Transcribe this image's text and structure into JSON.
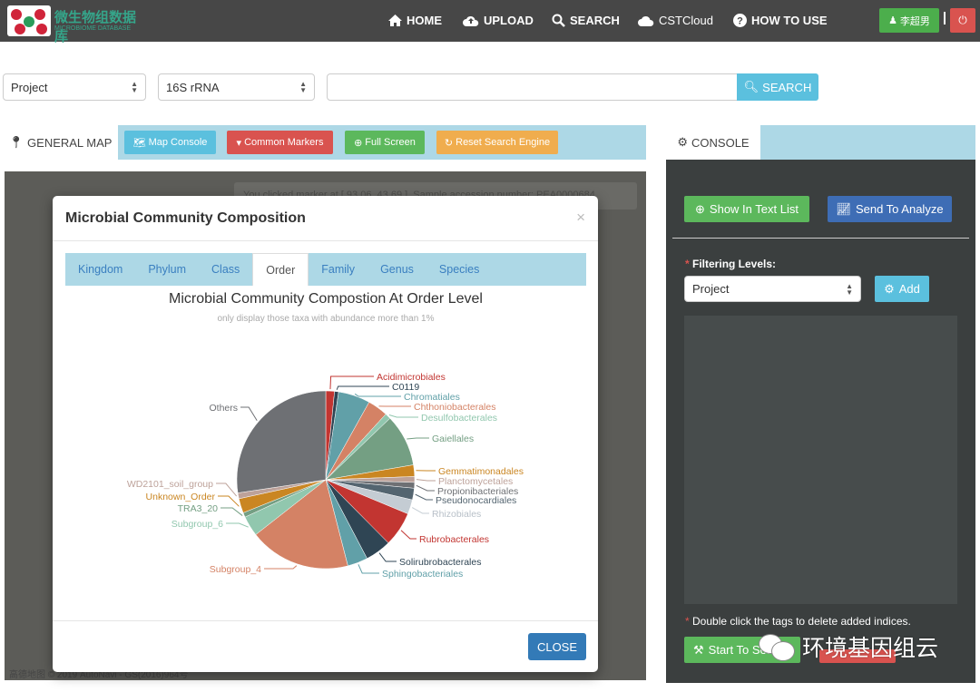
{
  "nav": {
    "logo_cn": "微生物组数据库",
    "logo_en": "MICROBIOME DATABASE",
    "items": [
      {
        "label": "HOME",
        "icon": "home-icon"
      },
      {
        "label": "UPLOAD",
        "icon": "cloud-upload-icon"
      },
      {
        "label": "SEARCH",
        "icon": "search-icon"
      },
      {
        "label": "CSTCloud",
        "icon": "cloud-icon"
      },
      {
        "label": "HOW TO USE",
        "icon": "question-icon"
      }
    ],
    "user": "李超男"
  },
  "search": {
    "scope": "Project",
    "type": "16S rRNA",
    "query": "",
    "button": "SEARCH"
  },
  "map_tabs": {
    "active": "GENERAL MAP",
    "buttons": [
      "Map Console",
      "Common Markers",
      "Full Screen",
      "Reset Search Engine"
    ],
    "colors": [
      "#5bc0de",
      "#d9534f",
      "#5cb85c",
      "#f0ad4e"
    ]
  },
  "map": {
    "message": "You clicked marker at [ 93.06, 43.69 ]. Sample accession number: PEA0000684",
    "attribution": "高德地图 © 2019 AutoNavi - GS(2016)964号"
  },
  "modal": {
    "title": "Microbial Community Composition",
    "tabs": [
      "Kingdom",
      "Phylum",
      "Class",
      "Order",
      "Family",
      "Genus",
      "Species"
    ],
    "active_tab": "Order",
    "close": "CLOSE"
  },
  "chart_data": {
    "type": "pie",
    "title": "Microbial Community Compostion At Order Level",
    "subtitle": "only display those taxa with abundance more than 1%",
    "slices": [
      {
        "name": "Acidimicrobiales",
        "value": 1.5,
        "color": "#c23531"
      },
      {
        "name": "C0119",
        "value": 0.7,
        "color": "#2f4554"
      },
      {
        "name": "Chromatiales",
        "value": 5.5,
        "color": "#61a0a8"
      },
      {
        "name": "Chthoniobacterales",
        "value": 3.5,
        "color": "#d48265"
      },
      {
        "name": "Desulfobacterales",
        "value": 1.0,
        "color": "#91c7ae"
      },
      {
        "name": "Gaiellales",
        "value": 9.0,
        "color": "#749f83"
      },
      {
        "name": "Gemmatimonadales",
        "value": 2.0,
        "color": "#ca8622"
      },
      {
        "name": "Planctomycetales",
        "value": 1.0,
        "color": "#bda29a"
      },
      {
        "name": "Propionibacteriales",
        "value": 1.0,
        "color": "#6e7074"
      },
      {
        "name": "Pseudonocardiales",
        "value": 2.0,
        "color": "#546570"
      },
      {
        "name": "Rhizobiales",
        "value": 2.5,
        "color": "#c4ccd3"
      },
      {
        "name": "Rubrobacterales",
        "value": 6.0,
        "color": "#c23531"
      },
      {
        "name": "Solirubrobacterales",
        "value": 4.5,
        "color": "#2f4554"
      },
      {
        "name": "Sphingobacteriales",
        "value": 3.5,
        "color": "#61a0a8"
      },
      {
        "name": "Subgroup_4",
        "value": 17.5,
        "color": "#d48265"
      },
      {
        "name": "Subgroup_6",
        "value": 3.5,
        "color": "#91c7ae"
      },
      {
        "name": "TRA3_20",
        "value": 0.8,
        "color": "#749f83"
      },
      {
        "name": "Unknown_Order",
        "value": 2.5,
        "color": "#ca8622"
      },
      {
        "name": "WD2101_soil_group",
        "value": 1.0,
        "color": "#bda29a"
      },
      {
        "name": "Others",
        "value": 26.0,
        "color": "#6e7074"
      }
    ]
  },
  "console": {
    "tab": "CONSOLE",
    "show_text_list": "Show In Text List",
    "send_to_analyze": "Send To Analyze",
    "filter_label": "Filtering Levels:",
    "filter_value": "Project",
    "add": "Add",
    "hint": "Double click the tags to delete added indices.",
    "start": "Start To Search"
  },
  "watermark": "环境基因组云"
}
